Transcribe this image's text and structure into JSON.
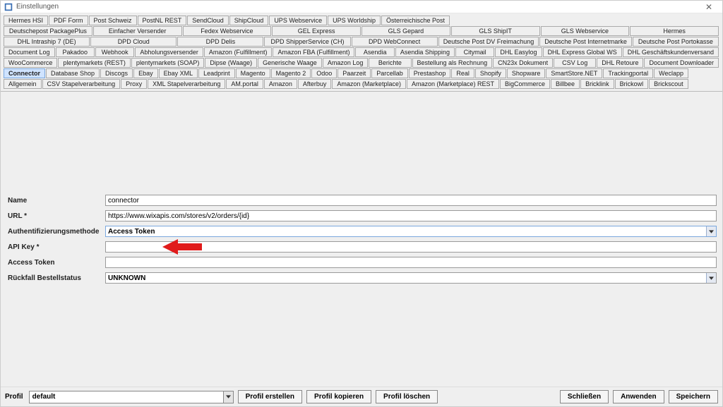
{
  "window": {
    "title": "Einstellungen"
  },
  "tabs": {
    "row0": [
      "Hermes HSI",
      "PDF Form",
      "Post Schweiz",
      "PostNL REST",
      "SendCloud",
      "ShipCloud",
      "UPS Webservice",
      "UPS Worldship",
      "Österreichische Post"
    ],
    "row1": [
      "Deutschepost PackagePlus",
      "Einfacher Versender",
      "Fedex Webservice",
      "GEL Express",
      "GLS Gepard",
      "GLS ShipIT",
      "GLS Webservice",
      "Hermes"
    ],
    "row2": [
      "DHL Intraship 7 (DE)",
      "DPD Cloud",
      "DPD Delis",
      "DPD ShipperService (CH)",
      "DPD WebConnect",
      "Deutsche Post DV Freimachung",
      "Deutsche Post Internetmarke",
      "Deutsche Post Portokasse"
    ],
    "row3": [
      "Document Log",
      "Pakadoo",
      "Webhook",
      "Abholungsversender",
      "Amazon (Fulfillment)",
      "Amazon FBA (Fulfillment)",
      "Asendia",
      "Asendia Shipping",
      "Citymail",
      "DHL Easylog",
      "DHL Express Global WS",
      "DHL Geschäftskundenversand"
    ],
    "row4": [
      "WooCommerce",
      "plentymarkets (REST)",
      "plentymarkets (SOAP)",
      "Dipse (Waage)",
      "Generische Waage",
      "Amazon Log",
      "Berichte",
      "Bestellung als Rechnung",
      "CN23x Dokument",
      "CSV Log",
      "DHL Retoure",
      "Document Downloader"
    ],
    "row5": [
      "Connector",
      "Database Shop",
      "Discogs",
      "Ebay",
      "Ebay XML",
      "Leadprint",
      "Magento",
      "Magento 2",
      "Odoo",
      "Paarzeit",
      "Parcellab",
      "Prestashop",
      "Real",
      "Shopify",
      "Shopware",
      "SmartStore.NET",
      "Trackingportal",
      "Weclapp"
    ],
    "row6": [
      "Allgemein",
      "CSV Stapelverarbeitung",
      "Proxy",
      "XML Stapelverarbeitung",
      "AM.portal",
      "Amazon",
      "Afterbuy",
      "Amazon (Marketplace)",
      "Amazon (Marketplace) REST",
      "BigCommerce",
      "Billbee",
      "Bricklink",
      "Brickowl",
      "Brickscout"
    ]
  },
  "active_tab": "Connector",
  "form": {
    "name_label": "Name",
    "name_value": "connector",
    "url_label": "URL *",
    "url_value": "https://www.wixapis.com/stores/v2/orders/{id}",
    "auth_label": "Authentifizierungsmethode",
    "auth_value": "Access Token",
    "apikey_label": "API Key *",
    "apikey_value": "",
    "token_label": "Access Token",
    "token_value": "",
    "fallback_label": "Rückfall Bestellstatus",
    "fallback_value": "UNKNOWN"
  },
  "footer": {
    "profil_label": "Profil",
    "profil_value": "default",
    "create": "Profil erstellen",
    "copy": "Profil kopieren",
    "delete": "Profil löschen",
    "close": "Schließen",
    "apply": "Anwenden",
    "save": "Speichern"
  }
}
